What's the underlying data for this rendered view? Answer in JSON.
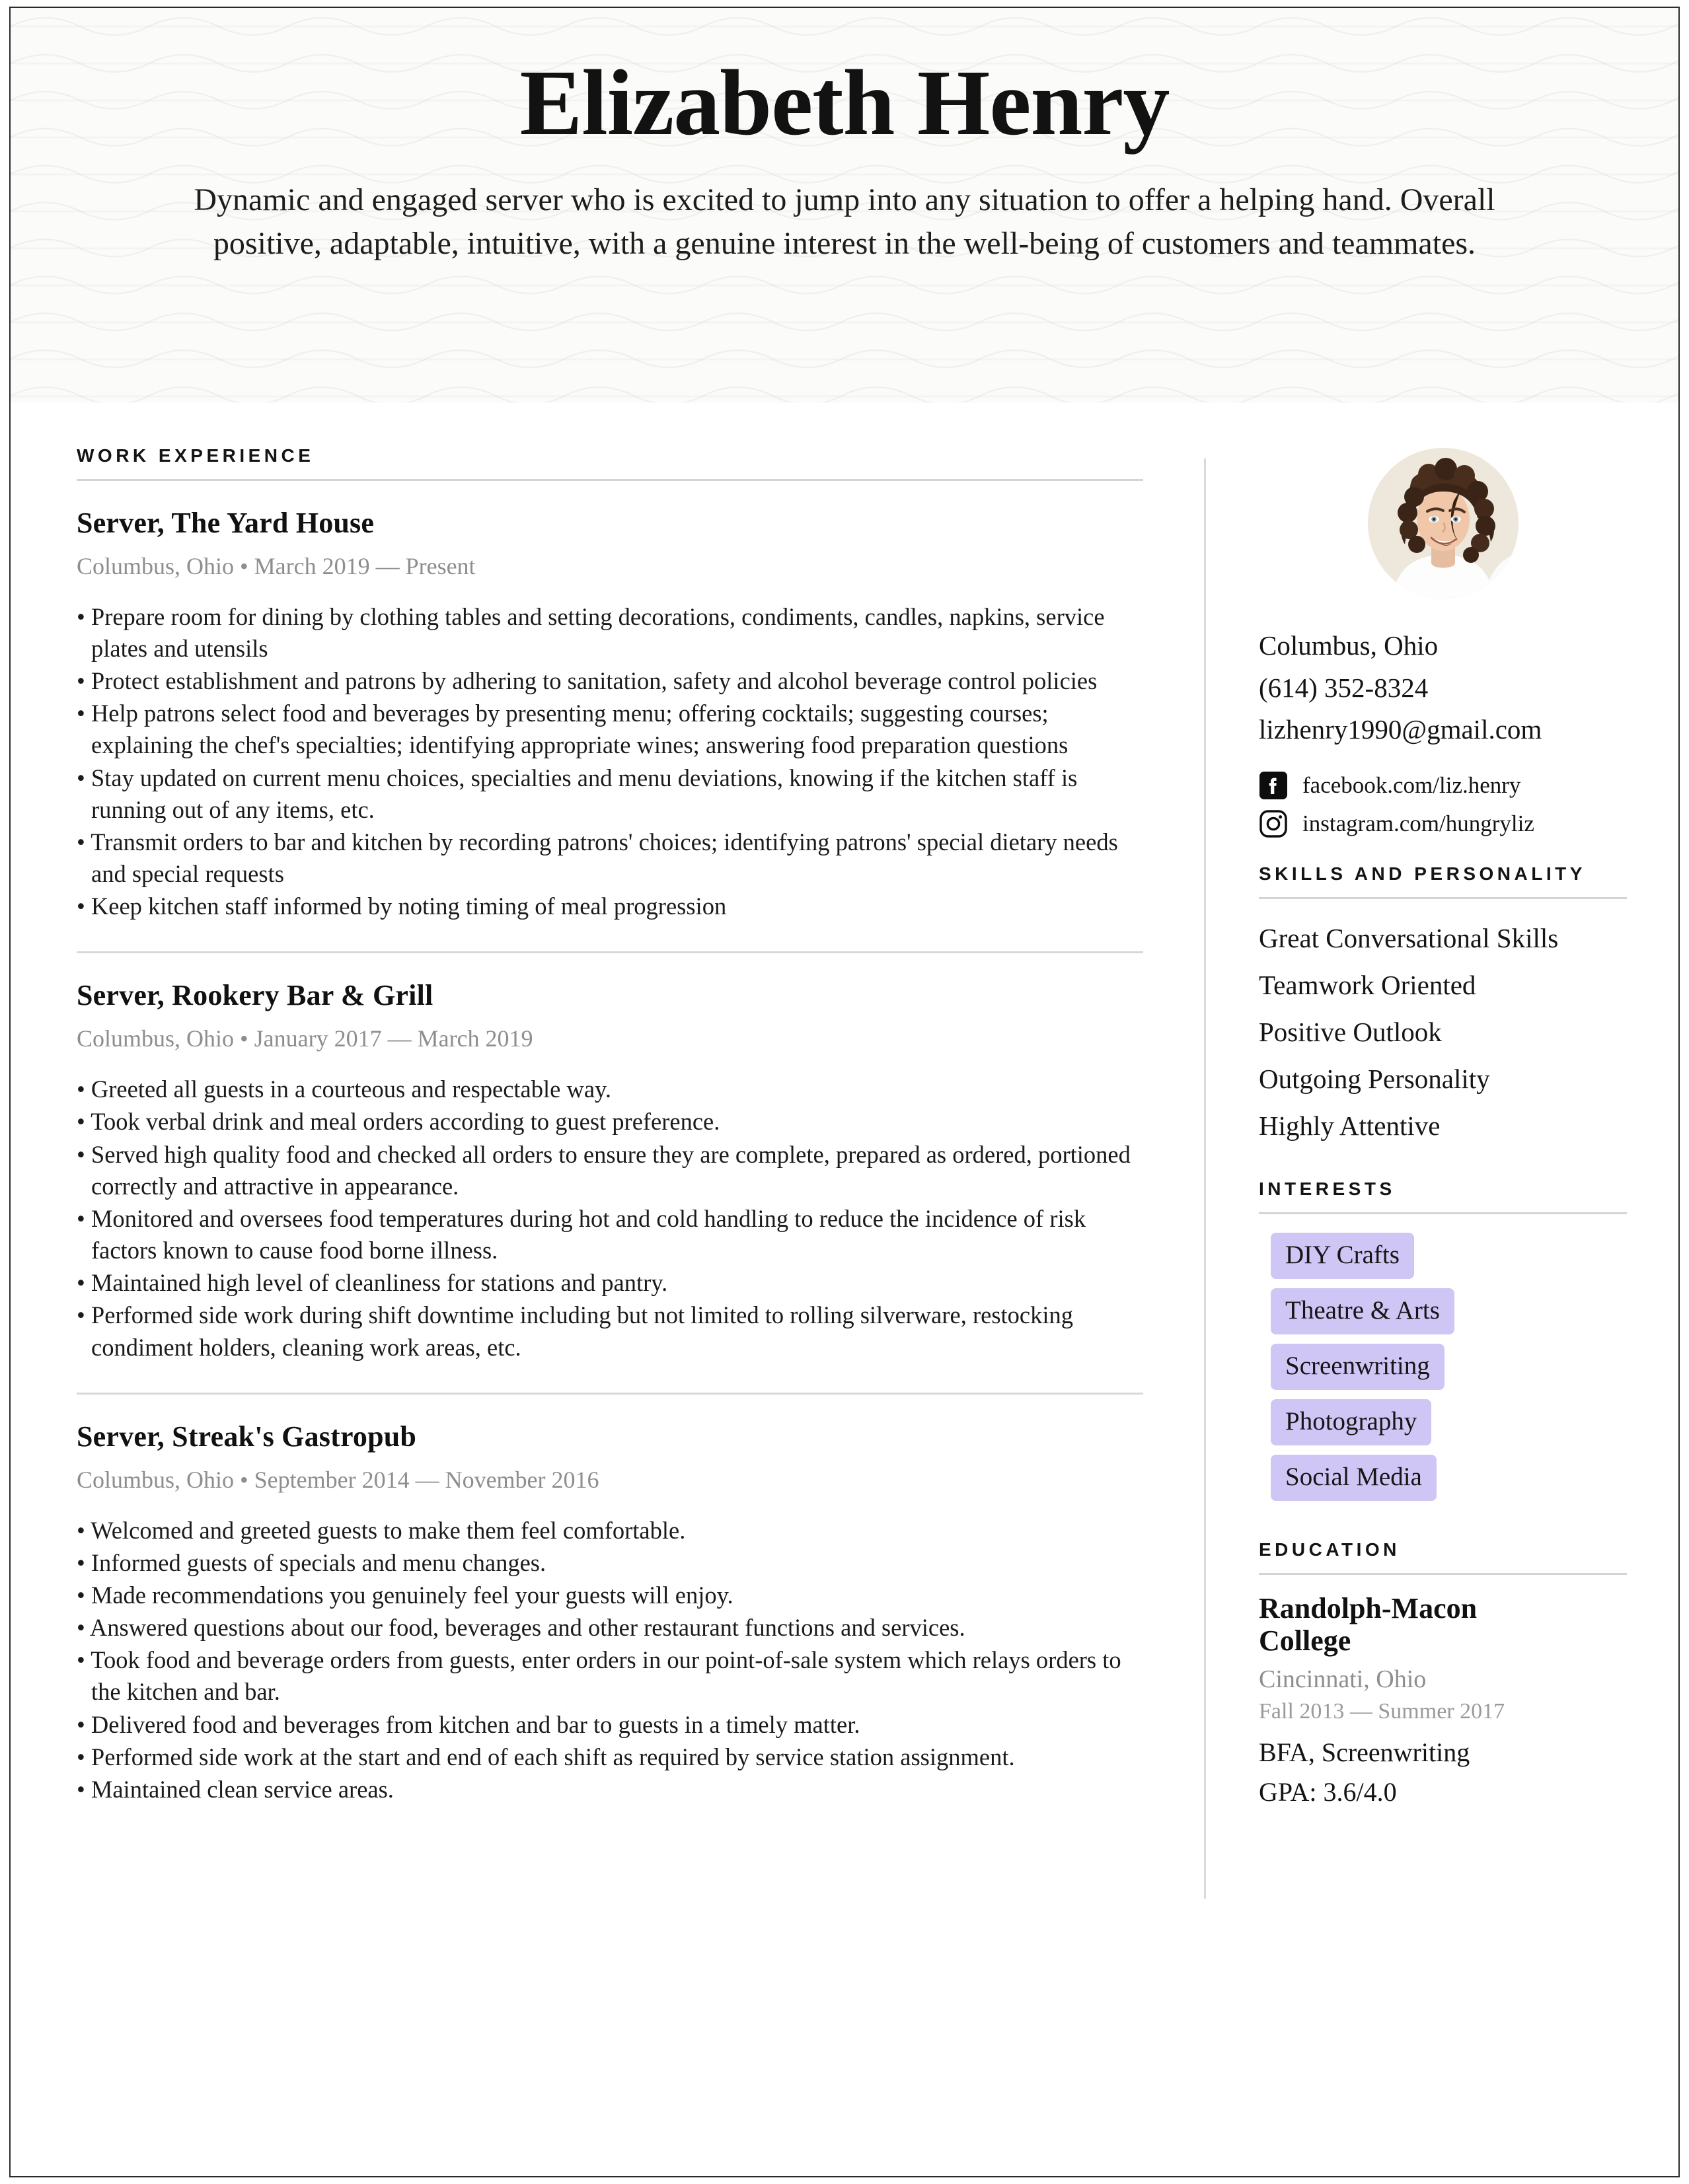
{
  "theme": {
    "accent_tag_bg": "#cfc6f5",
    "rule_color": "#d4d4d4",
    "muted_text": "#8e8e8e",
    "page_border": "#2b2b2b",
    "header_bg": "#fbfbf9"
  },
  "header": {
    "name": "Elizabeth Henry",
    "summary": "Dynamic and engaged server who is excited to jump into any situation to offer a helping hand. Overall positive, adaptable, intuitive, with a genuine interest in the well-being of customers and teammates."
  },
  "work": {
    "heading": "WORK EXPERIENCE",
    "jobs": [
      {
        "title": "Server, The Yard House",
        "meta": "Columbus, Ohio • March 2019 — Present",
        "bullets": [
          "• Prepare room for dining by clothing tables and setting decorations, condiments, candles, napkins, service plates and utensils",
          "• Protect establishment and patrons by adhering to sanitation, safety and alcohol beverage control policies",
          "• Help patrons select food and beverages by presenting menu; offering cocktails; suggesting courses; explaining the chef's specialties; identifying appropriate wines; answering food preparation questions",
          "• Stay updated on current menu choices, specialties and menu deviations, knowing if the kitchen staff is running out of any items, etc.",
          "• Transmit orders to bar and kitchen by recording patrons' choices; identifying patrons' special dietary needs and special requests",
          "• Keep kitchen staff informed by noting timing of meal progression"
        ]
      },
      {
        "title": "Server, Rookery Bar & Grill",
        "meta": "Columbus, Ohio • January 2017 — March 2019",
        "bullets": [
          "• Greeted all guests in a courteous and respectable way.",
          "• Took verbal drink and meal orders according to guest preference.",
          "• Served high quality food and checked all orders to ensure they are complete, prepared as ordered, portioned correctly and attractive in appearance.",
          "• Monitored and oversees food temperatures during hot and cold handling to reduce the incidence of risk factors known to cause food borne illness.",
          "• Maintained high level of cleanliness for stations and pantry.",
          "• Performed side work during shift downtime including but not limited to rolling silverware, restocking condiment holders, cleaning work areas, etc."
        ]
      },
      {
        "title": "Server, Streak's Gastropub",
        "meta": "Columbus, Ohio • September 2014 — November 2016",
        "bullets": [
          "• Welcomed and greeted guests to make them feel comfortable.",
          "• Informed guests of specials and menu changes.",
          "• Made recommendations you genuinely feel your guests will enjoy.",
          "• Answered questions about our food, beverages and other restaurant functions and services.",
          "• Took food and beverage orders from guests, enter orders in our point-of-sale system which relays orders to the kitchen and bar.",
          "• Delivered food and beverages from kitchen and bar to guests in a timely matter.",
          "• Performed side work at the start and end of each shift as required by service station assignment.",
          "• Maintained clean service areas."
        ]
      }
    ]
  },
  "sidebar": {
    "avatar_alt": "portrait-photo",
    "contact": {
      "location": "Columbus, Ohio",
      "phone": "(614) 352-8324",
      "email": "lizhenry1990@gmail.com"
    },
    "social": [
      {
        "icon": "facebook-icon",
        "label": "facebook.com/liz.henry"
      },
      {
        "icon": "instagram-icon",
        "label": "instagram.com/hungryliz"
      }
    ],
    "skills": {
      "heading": "SKILLS AND PERSONALITY",
      "items": [
        "Great Conversational Skills",
        "Teamwork Oriented",
        "Positive Outlook",
        "Outgoing Personality",
        "Highly Attentive"
      ]
    },
    "interests": {
      "heading": "INTERESTS",
      "items": [
        "DIY Crafts",
        "Theatre & Arts",
        "Screenwriting",
        "Photography",
        "Social Media"
      ]
    },
    "education": {
      "heading": "EDUCATION",
      "school": "Randolph-Macon College",
      "place": "Cincinnati, Ohio",
      "dates": "Fall 2013 — Summer 2017",
      "degree": "BFA, Screenwriting",
      "gpa": "GPA: 3.6/4.0"
    }
  }
}
